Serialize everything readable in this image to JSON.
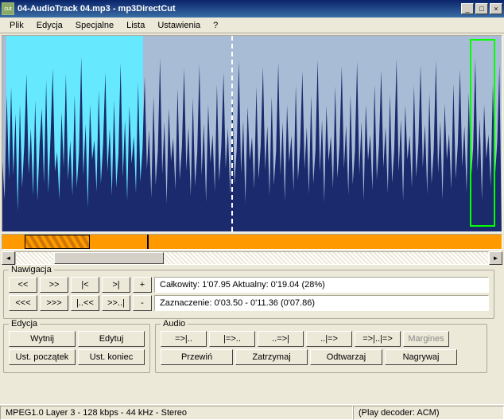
{
  "window": {
    "title": "04-AudioTrack 04.mp3 - mp3DirectCut"
  },
  "menu": [
    "Plik",
    "Edycja",
    "Specjalne",
    "Lista",
    "Ustawienia",
    "?"
  ],
  "nav": {
    "legend": "Nawigacja",
    "buttons1": [
      "<<",
      ">>",
      "|<",
      ">|",
      "+"
    ],
    "buttons2": [
      "<<<",
      ">>>",
      "|..<<",
      ">>..|",
      "-"
    ],
    "info1": "Całkowity: 1'07.95   Aktualny: 0'19.04   (28%)",
    "info2": "Zaznaczenie: 0'03.50 - 0'11.36 (0'07.86)"
  },
  "edit": {
    "legend": "Edycja",
    "b1": "Wytnij",
    "b2": "Edytuj",
    "b3": "Ust. początek",
    "b4": "Ust. koniec"
  },
  "audio": {
    "legend": "Audio",
    "row1": [
      "=>|..",
      "|=>..",
      "..=>|",
      "..|=>",
      "=>|..|=>",
      "Margines"
    ],
    "row2": [
      "Przewiń",
      "Zatrzymaj",
      "Odtwarzaj",
      "Nagrywaj"
    ]
  },
  "status": {
    "left": "MPEG1.0 Layer 3 - 128 kbps - 44 kHz - Stereo",
    "right": "(Play decoder: ACM)"
  },
  "chart_data": {
    "type": "waveform",
    "title": "Audio amplitude",
    "x_range_seconds": [
      0,
      67.95
    ],
    "selection_seconds": [
      3.5,
      11.36
    ],
    "playhead_seconds": 19.04,
    "samples": [
      88,
      40,
      172,
      65,
      182,
      70,
      148,
      25,
      160,
      55,
      108,
      198,
      72,
      130,
      45,
      165,
      38,
      110,
      155,
      60,
      190,
      48,
      120,
      205,
      75,
      100,
      40,
      150,
      80,
      198,
      65,
      115,
      45,
      172,
      55,
      100,
      220,
      70,
      135,
      30,
      160,
      90,
      115,
      50,
      178,
      60,
      110,
      200,
      75,
      130,
      45,
      165,
      55,
      98,
      212,
      68,
      140,
      38,
      158,
      85,
      120,
      48,
      188,
      62,
      105,
      195,
      78,
      128,
      42,
      170,
      58,
      102,
      218,
      72,
      138,
      35,
      155,
      88,
      118,
      52,
      180,
      65,
      108,
      205,
      76,
      132,
      44,
      168,
      57,
      100,
      210,
      70,
      136,
      37,
      160,
      86,
      122,
      50,
      185,
      63,
      107,
      200,
      79,
      130,
      46,
      172,
      59,
      103,
      215,
      73,
      139,
      36,
      157,
      89,
      119,
      53,
      182,
      66,
      109,
      207,
      77,
      133,
      45,
      170,
      58,
      101,
      213,
      71,
      137,
      38,
      159,
      87,
      121,
      51,
      184,
      64,
      108,
      202,
      78,
      131,
      47,
      171,
      60,
      104,
      216,
      74,
      140,
      37,
      158,
      88,
      120,
      54,
      183,
      67,
      110,
      208,
      79,
      134,
      46,
      172,
      59,
      102,
      214,
      72,
      138,
      39,
      160,
      89,
      122,
      52,
      185,
      65,
      109,
      203,
      80,
      132,
      48,
      173,
      61,
      105,
      217,
      75,
      141,
      38,
      159,
      90,
      121,
      55,
      184,
      68,
      111,
      209,
      80,
      135,
      47,
      174,
      60,
      103,
      215,
      73,
      139,
      40,
      161,
      90,
      123,
      53,
      186,
      66,
      110,
      204,
      81,
      133,
      49,
      175,
      62,
      106,
      218,
      76,
      142,
      39,
      160,
      91,
      122,
      56,
      185,
      69,
      112,
      210
    ]
  }
}
